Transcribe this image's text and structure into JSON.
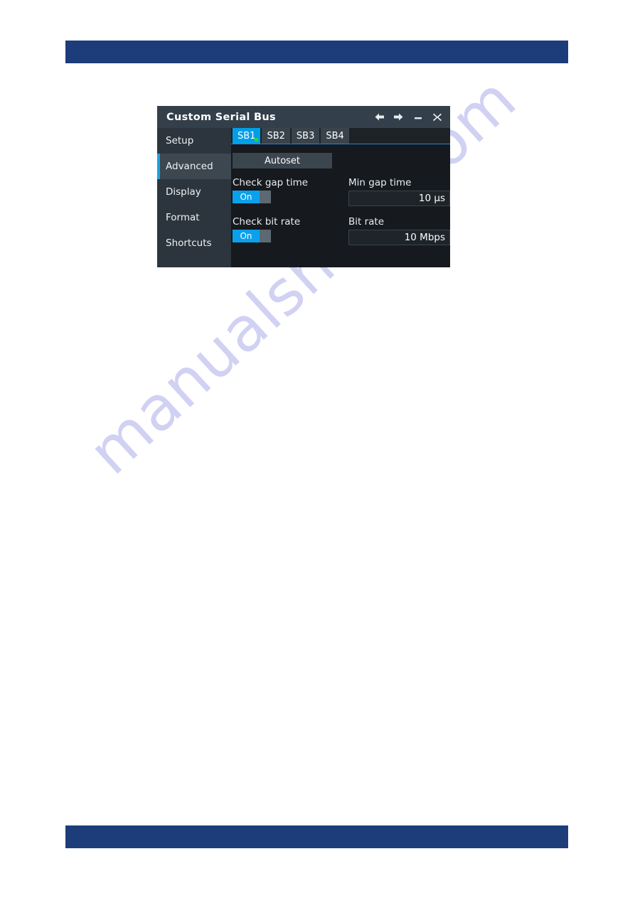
{
  "page": {
    "header_bar_color": "#1d3c7a",
    "footer_bar_color": "#1d3c7a",
    "watermark_text": "manualshive.com"
  },
  "dialog": {
    "title": "Custom Serial Bus",
    "window_buttons": [
      {
        "name": "back",
        "glyph": "←"
      },
      {
        "name": "forward",
        "glyph": "→"
      },
      {
        "name": "minimize",
        "glyph": "—"
      },
      {
        "name": "close",
        "glyph": "✕"
      }
    ],
    "sidebar": {
      "items": [
        {
          "label": "Setup",
          "active": false
        },
        {
          "label": "Advanced",
          "active": true
        },
        {
          "label": "Display",
          "active": false
        },
        {
          "label": "Format",
          "active": false
        },
        {
          "label": "Shortcuts",
          "active": false
        }
      ]
    },
    "tabs": [
      {
        "label": "SB1",
        "active": true,
        "indicator": "green"
      },
      {
        "label": "SB2",
        "active": false,
        "indicator": ""
      },
      {
        "label": "SB3",
        "active": false,
        "indicator": ""
      },
      {
        "label": "SB4",
        "active": false,
        "indicator": ""
      }
    ],
    "content": {
      "autoset_label": "Autoset",
      "check_gap_time": {
        "label": "Check gap time",
        "state": "On"
      },
      "min_gap_time": {
        "label": "Min gap time",
        "value": "10 µs"
      },
      "check_bit_rate": {
        "label": "Check bit rate",
        "state": "On"
      },
      "bit_rate": {
        "label": "Bit rate",
        "value": "10 Mbps"
      }
    },
    "colors": {
      "accent_blue": "#00a0e8",
      "active_tab": "#00a0e8",
      "toggle_on": "#0aa1ec",
      "sidebar_marker": "#1ba1e2",
      "tab_indicator_green": "#30d030",
      "titlebar": "#333f4a",
      "sidebar_bg": "#2c353d",
      "content_bg": "#16191d"
    }
  }
}
